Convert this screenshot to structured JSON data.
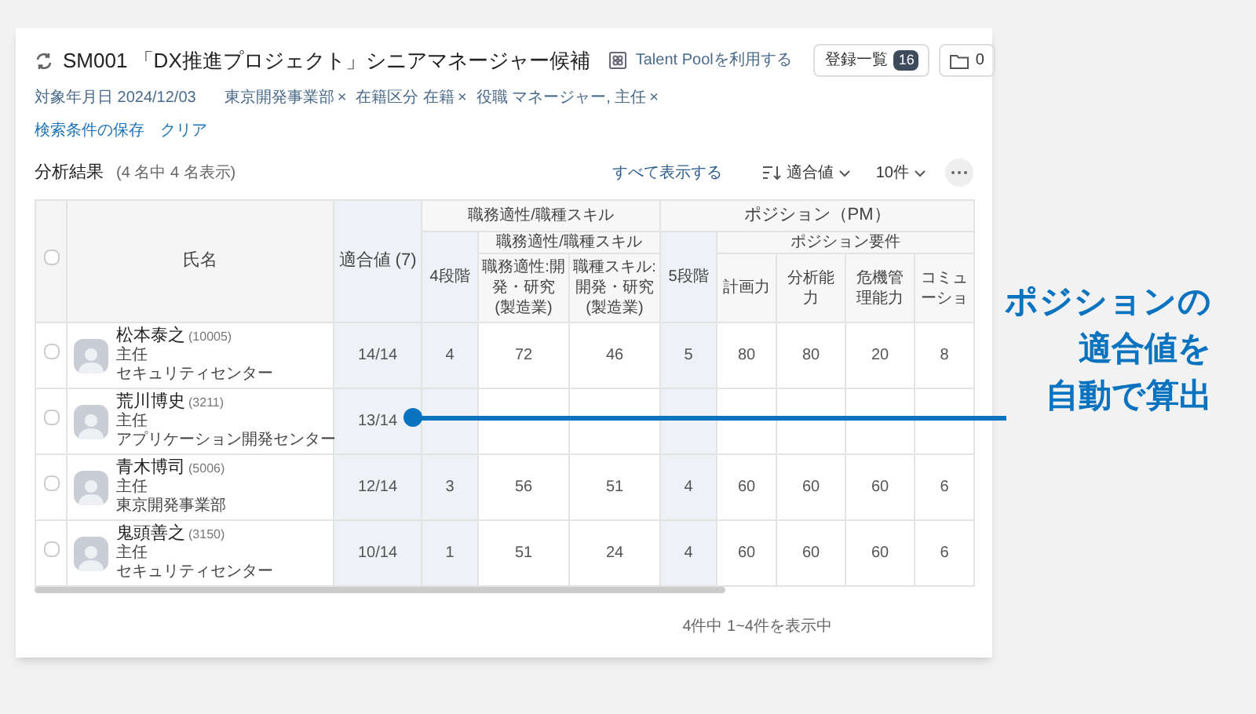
{
  "header": {
    "title": "SM001 「DX推進プロジェクト」シニアマネージャー候補",
    "talent_pool_link": "Talent Poolを利用する",
    "registered_button": {
      "label": "登録一覧",
      "count": "16"
    },
    "folder_button": {
      "count": "0"
    }
  },
  "filters": {
    "date_label": "対象年月日 2024/12/03",
    "chips": [
      {
        "label": "東京開発事業部",
        "remove": "×"
      },
      {
        "label": "在籍区分 在籍",
        "remove": "×"
      },
      {
        "label": "役職 マネージャー, 主任",
        "remove": "×"
      }
    ]
  },
  "links": [
    "検索条件の保存",
    "クリア"
  ],
  "results": {
    "title": "分析結果",
    "count": "(4 名中 4 名表示)",
    "show_all": "すべて表示する",
    "sort": "適合値",
    "per_page": "10件"
  },
  "table": {
    "select_all_checked": false,
    "name_header": "氏名",
    "fit_header": "適合値 (7)",
    "group_1": {
      "title": "職務適性/職種スキル",
      "scale": "4段階",
      "subgroup": "職務適性/職種スキル",
      "columns": [
        "職務適性:開発・研究(製造業)",
        "職種スキル:開発・研究(製造業)"
      ]
    },
    "group_2": {
      "title": "ポジション（PM）",
      "scale": "5段階",
      "subgroup": "ポジション要件",
      "columns": [
        "計画力",
        "分析能力",
        "危機管理能力",
        "コミューショ"
      ]
    },
    "rows": [
      {
        "checked": false,
        "name": "松本泰之",
        "id": "(10005)",
        "role": "主任",
        "dept": "セキュリティセンター",
        "fit": "14/14",
        "values": [
          "4",
          "72",
          "46",
          "5",
          "80",
          "80",
          "20",
          "8"
        ]
      },
      {
        "checked": false,
        "name": "荒川博史",
        "id": "(3211)",
        "role": "主任",
        "dept": "アプリケーション開発センター",
        "fit": "13/14"
      },
      {
        "checked": false,
        "name": "青木博司",
        "id": "(5006)",
        "role": "主任",
        "dept": "東京開発事業部",
        "fit": "12/14",
        "values": [
          "3",
          "56",
          "51",
          "4",
          "60",
          "60",
          "60",
          "6"
        ]
      },
      {
        "checked": false,
        "name": "鬼頭善之",
        "id": "(3150)",
        "role": "主任",
        "dept": "セキュリティセンター",
        "fit": "10/14",
        "values": [
          "1",
          "51",
          "24",
          "4",
          "60",
          "60",
          "60",
          "6"
        ]
      }
    ]
  },
  "pagination": "4件中 1~4件を表示中",
  "callout": {
    "lines": [
      "ポジションの",
      "適合値を",
      "自動で算出"
    ]
  }
}
